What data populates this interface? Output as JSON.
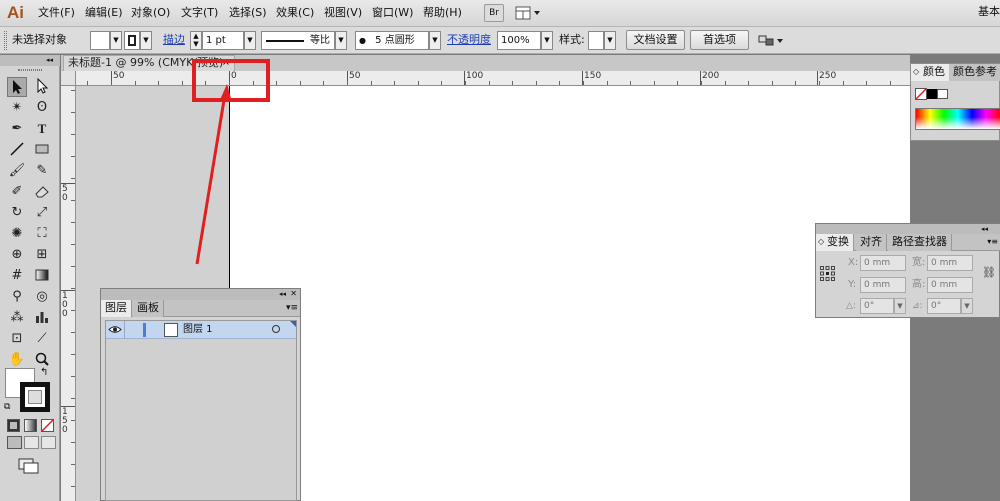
{
  "app": {
    "logo": "Ai",
    "menus": [
      "文件(F)",
      "编辑(E)",
      "对象(O)",
      "文字(T)",
      "选择(S)",
      "效果(C)",
      "视图(V)",
      "窗口(W)",
      "帮助(H)"
    ],
    "bridge_button": "Br",
    "arrange_icon": "arrange-documents-icon",
    "workspace_label": "基本"
  },
  "control_bar": {
    "selection_status": "未选择对象",
    "stroke_link": "描边",
    "stroke_weight": "1 pt",
    "stroke_profile": "等比",
    "brush_label": "5 点圆形",
    "brush_dot": "●",
    "opacity_link": "不透明度",
    "opacity_value": "100%",
    "style_label": "样式:",
    "doc_setup_button": "文档设置",
    "preferences_button": "首选项"
  },
  "document": {
    "tab_title": "未标题-1 @ 99% (CMYK/预览)",
    "close_glyph": "×"
  },
  "ruler": {
    "horizontal_labels": [
      "50",
      "0",
      "50",
      "100",
      "150",
      "200",
      "250"
    ],
    "vertical_labels": [
      "5 0",
      "1 0 0",
      "1 5 0"
    ]
  },
  "panels": {
    "color": {
      "tabs": [
        "颜色",
        "颜色参考"
      ],
      "spectrum_colors": [
        "#ff0000",
        "#ffff00",
        "#00ff00",
        "#00ffff",
        "#0000ff",
        "#ff00ff",
        "#ff0000"
      ]
    },
    "layers": {
      "tabs": [
        "图层",
        "画板"
      ],
      "layer_name": "图层 1",
      "visibility_icon": "eye-icon",
      "target_icon": "target-circle-icon"
    },
    "transform": {
      "tabs": [
        "变换",
        "对齐",
        "路径查找器"
      ],
      "x_label": "X:",
      "x_value": "0 mm",
      "y_label": "Y:",
      "y_value": "0 mm",
      "w_label": "宽:",
      "w_value": "0 mm",
      "h_label": "高:",
      "h_value": "0 mm",
      "rotate_value": "0°",
      "shear_value": "0°"
    }
  },
  "colors": {
    "highlight": "#e02020",
    "ai_brand": "#a8531b"
  }
}
